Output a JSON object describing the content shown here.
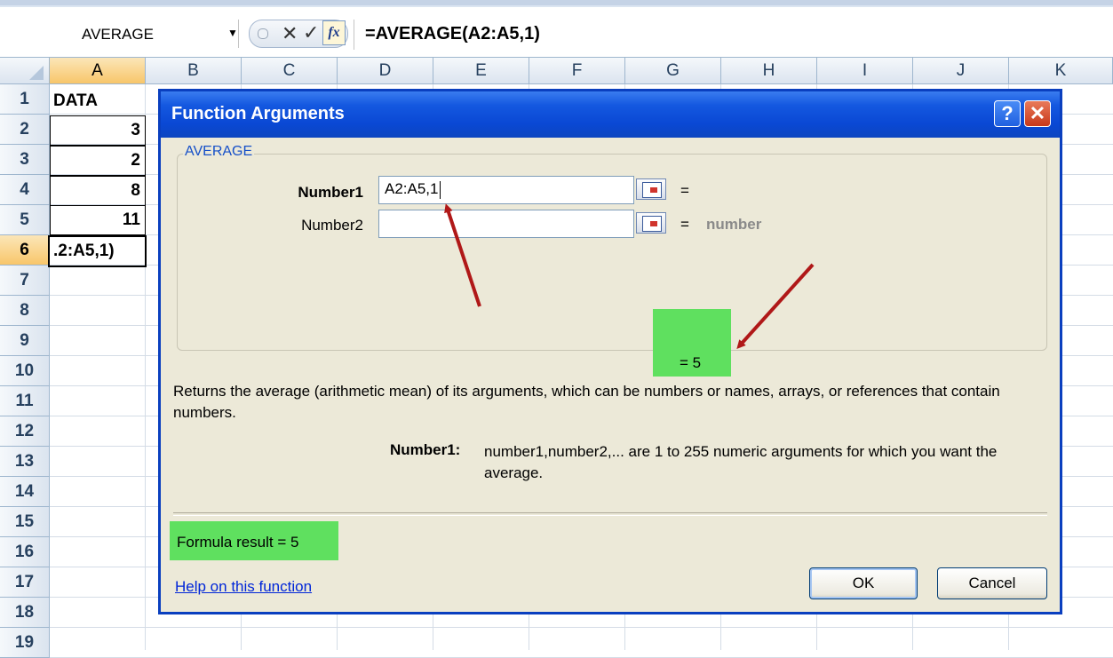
{
  "formula_bar": {
    "name_box": "AVERAGE",
    "cancel_symbol": "✕",
    "enter_symbol": "✓",
    "fx_label": "fx",
    "formula": "=AVERAGE(A2:A5,1)"
  },
  "columns": [
    "A",
    "B",
    "C",
    "D",
    "E",
    "F",
    "G",
    "H",
    "I",
    "J",
    "K"
  ],
  "rows": [
    "1",
    "2",
    "3",
    "4",
    "5",
    "6",
    "7",
    "8",
    "9",
    "10",
    "11",
    "12",
    "13",
    "14",
    "15",
    "16",
    "17",
    "18",
    "19"
  ],
  "cells": {
    "A1": "DATA",
    "A2": "3",
    "A3": "2",
    "A4": "8",
    "A5": "11",
    "A6": ".2:A5,1)"
  },
  "dialog": {
    "title": "Function Arguments",
    "help_btn": "?",
    "close_btn": "✕",
    "function_name": "AVERAGE",
    "args": [
      {
        "label": "Number1",
        "value": "A2:A5,1",
        "result": ""
      },
      {
        "label": "Number2",
        "value": "",
        "result": "number"
      }
    ],
    "equals": "=",
    "result_line": "=  5",
    "description": "Returns the average (arithmetic mean) of its arguments, which can be numbers or names, arrays, or references that contain numbers.",
    "arg_help_label": "Number1:",
    "arg_help_text": "number1,number2,... are 1 to 255 numeric arguments for which you want the average.",
    "formula_result": "Formula result =  5",
    "help_link": "Help on this function",
    "ok": "OK",
    "cancel": "Cancel"
  },
  "colors": {
    "highlight_green": "#5fe05f",
    "arrow_red": "#b01818",
    "title_blue": "#0a48d4"
  }
}
